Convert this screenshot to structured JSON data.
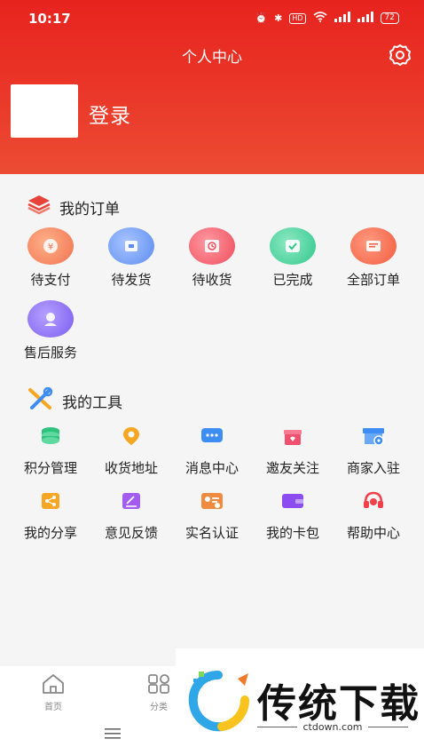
{
  "status": {
    "time": "10:17",
    "hd": "HD",
    "battery": "72"
  },
  "header": {
    "title": "个人中心",
    "login_label": "登录"
  },
  "orders": {
    "title": "我的订单",
    "items": [
      {
        "label": "待支付",
        "icon": "wallet-icon",
        "color": "#f0734f"
      },
      {
        "label": "待发货",
        "icon": "package-icon",
        "color": "#5b8cf0"
      },
      {
        "label": "待收货",
        "icon": "clock-icon",
        "color": "#ef4b5a"
      },
      {
        "label": "已完成",
        "icon": "check-icon",
        "color": "#2fc88c"
      },
      {
        "label": "全部订单",
        "icon": "list-icon",
        "color": "#f25c3e"
      },
      {
        "label": "售后服务",
        "icon": "service-icon",
        "color": "#7a5cf0"
      }
    ]
  },
  "tools": {
    "title": "我的工具",
    "items": [
      {
        "label": "积分管理",
        "icon": "coins-icon",
        "color": "#2ec27e"
      },
      {
        "label": "收货地址",
        "icon": "location-icon",
        "color": "#f5a623"
      },
      {
        "label": "消息中心",
        "icon": "message-icon",
        "color": "#3d8df5"
      },
      {
        "label": "邀友关注",
        "icon": "gift-icon",
        "color": "#f0506e"
      },
      {
        "label": "商家入驻",
        "icon": "store-icon",
        "color": "#3d8df5"
      },
      {
        "label": "我的分享",
        "icon": "share-icon",
        "color": "#f5a623"
      },
      {
        "label": "意见反馈",
        "icon": "feedback-icon",
        "color": "#a35cf0"
      },
      {
        "label": "实名认证",
        "icon": "id-card-icon",
        "color": "#f08a3e"
      },
      {
        "label": "我的卡包",
        "icon": "card-wallet-icon",
        "color": "#8c4cf0"
      },
      {
        "label": "帮助中心",
        "icon": "help-icon",
        "color": "#f0404a"
      }
    ]
  },
  "bottom_nav": {
    "home": "首页",
    "category": "分类"
  },
  "watermark": {
    "text": "传统下载",
    "url": "ctdown.com"
  }
}
